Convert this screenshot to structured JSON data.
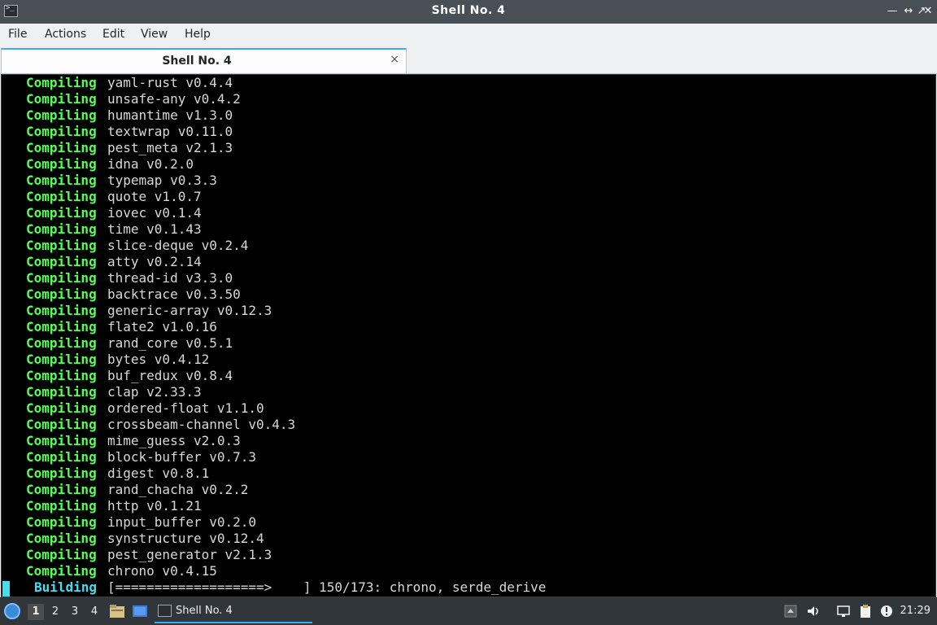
{
  "window": {
    "title": "Shell No. 4",
    "controls": [
      "minimize-icon",
      "restore-icon",
      "maximize-icon",
      "close-icon"
    ]
  },
  "menubar": {
    "items": [
      "File",
      "Actions",
      "Edit",
      "View",
      "Help"
    ]
  },
  "tabs": [
    {
      "label": "Shell No. 4",
      "close": "×"
    }
  ],
  "terminal": {
    "lines": [
      {
        "kw": "Compiling",
        "pkg": "yaml-rust v0.4.4"
      },
      {
        "kw": "Compiling",
        "pkg": "unsafe-any v0.4.2"
      },
      {
        "kw": "Compiling",
        "pkg": "humantime v1.3.0"
      },
      {
        "kw": "Compiling",
        "pkg": "textwrap v0.11.0"
      },
      {
        "kw": "Compiling",
        "pkg": "pest_meta v2.1.3"
      },
      {
        "kw": "Compiling",
        "pkg": "idna v0.2.0"
      },
      {
        "kw": "Compiling",
        "pkg": "typemap v0.3.3"
      },
      {
        "kw": "Compiling",
        "pkg": "quote v1.0.7"
      },
      {
        "kw": "Compiling",
        "pkg": "iovec v0.1.4"
      },
      {
        "kw": "Compiling",
        "pkg": "time v0.1.43"
      },
      {
        "kw": "Compiling",
        "pkg": "slice-deque v0.2.4"
      },
      {
        "kw": "Compiling",
        "pkg": "atty v0.2.14"
      },
      {
        "kw": "Compiling",
        "pkg": "thread-id v3.3.0"
      },
      {
        "kw": "Compiling",
        "pkg": "backtrace v0.3.50"
      },
      {
        "kw": "Compiling",
        "pkg": "generic-array v0.12.3"
      },
      {
        "kw": "Compiling",
        "pkg": "flate2 v1.0.16"
      },
      {
        "kw": "Compiling",
        "pkg": "rand_core v0.5.1"
      },
      {
        "kw": "Compiling",
        "pkg": "bytes v0.4.12"
      },
      {
        "kw": "Compiling",
        "pkg": "buf_redux v0.8.4"
      },
      {
        "kw": "Compiling",
        "pkg": "clap v2.33.3"
      },
      {
        "kw": "Compiling",
        "pkg": "ordered-float v1.1.0"
      },
      {
        "kw": "Compiling",
        "pkg": "crossbeam-channel v0.4.3"
      },
      {
        "kw": "Compiling",
        "pkg": "mime_guess v2.0.3"
      },
      {
        "kw": "Compiling",
        "pkg": "block-buffer v0.7.3"
      },
      {
        "kw": "Compiling",
        "pkg": "digest v0.8.1"
      },
      {
        "kw": "Compiling",
        "pkg": "rand_chacha v0.2.2"
      },
      {
        "kw": "Compiling",
        "pkg": "http v0.1.21"
      },
      {
        "kw": "Compiling",
        "pkg": "input_buffer v0.2.0"
      },
      {
        "kw": "Compiling",
        "pkg": "synstructure v0.12.4"
      },
      {
        "kw": "Compiling",
        "pkg": "pest_generator v2.1.3"
      },
      {
        "kw": "Compiling",
        "pkg": "chrono v0.4.15"
      }
    ],
    "status": {
      "kw": "Building",
      "progress": "[===================>    ] 150/173: chrono, serde_derive"
    }
  },
  "taskbar": {
    "workspaces": [
      "1",
      "2",
      "3",
      "4"
    ],
    "active_workspace": "1",
    "task_label": "Shell No. 4",
    "clock": "21:29"
  },
  "colors": {
    "keyword": "#54ff54",
    "building": "#40e0f0",
    "terminal_bg": "#000000",
    "accent": "#3daee9"
  }
}
